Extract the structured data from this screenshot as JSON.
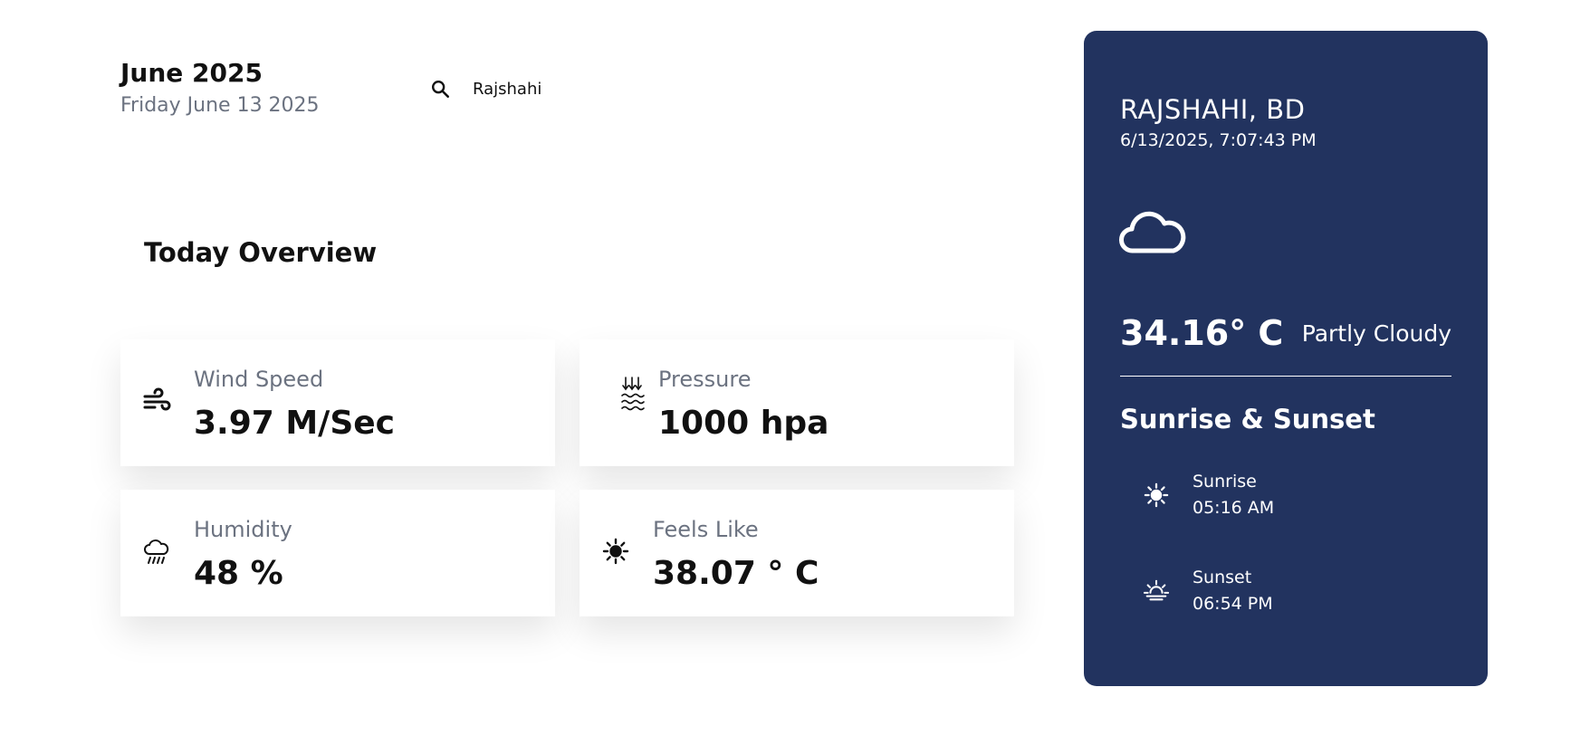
{
  "header": {
    "month_title": "June 2025",
    "date_line": "Friday June 13 2025"
  },
  "search": {
    "icon": "search-icon",
    "value": "Rajshahi"
  },
  "overview": {
    "title": "Today Overview",
    "cards": {
      "wind": {
        "label": "Wind Speed",
        "value": "3.97 M/Sec",
        "icon": "wind-icon"
      },
      "pressure": {
        "label": "Pressure",
        "value": "1000 hpa",
        "icon": "pressure-icon"
      },
      "humidity": {
        "label": "Humidity",
        "value": "48 %",
        "icon": "rain-cloud-icon"
      },
      "feels": {
        "label": "Feels Like",
        "value": "38.07 ° C",
        "icon": "sun-icon"
      }
    }
  },
  "panel": {
    "city": "RAJSHAHI, BD",
    "datetime": "6/13/2025, 7:07:43 PM",
    "weather_icon": "cloud-icon",
    "temperature": "34.16° C",
    "condition": "Partly Cloudy",
    "sun_title": "Sunrise & Sunset",
    "sunrise": {
      "label": "Sunrise",
      "time": "05:16 AM",
      "icon": "sun-icon"
    },
    "sunset": {
      "label": "Sunset",
      "time": "06:54 PM",
      "icon": "sunset-icon"
    },
    "background_color": "#22335f"
  }
}
